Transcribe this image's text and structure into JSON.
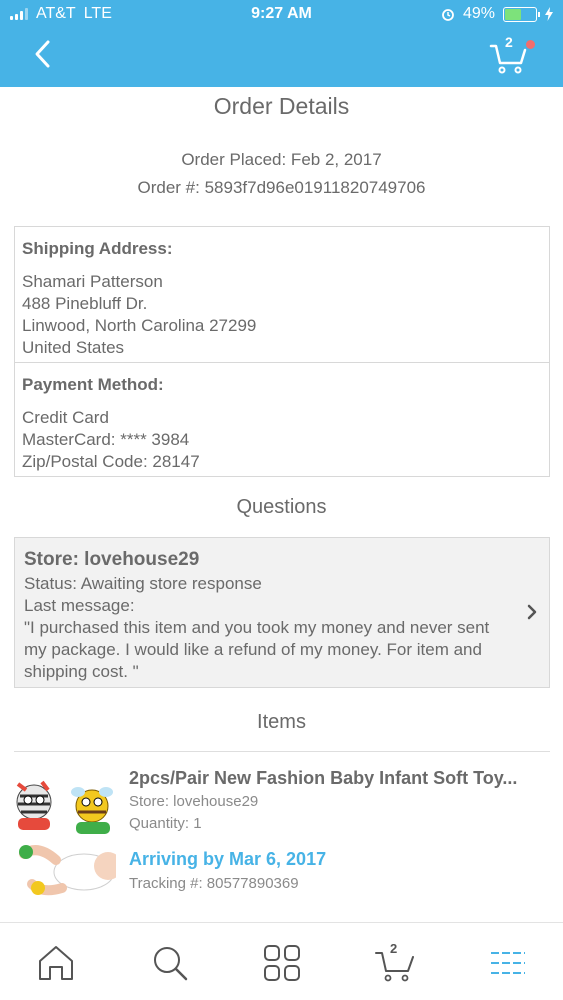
{
  "status_bar": {
    "carrier": "AT&T",
    "network": "LTE",
    "time": "9:27 AM",
    "battery": "49%"
  },
  "header": {
    "cart_count": "2",
    "accent_color": "#47b3e6"
  },
  "page": {
    "title": "Order Details",
    "order_placed": "Order Placed: Feb 2, 2017",
    "order_number": "Order #: 5893f7d96e01911820749706"
  },
  "shipping": {
    "heading": "Shipping Address:",
    "lines": [
      "Shamari Patterson",
      "488 Pinebluff Dr.",
      "Linwood, North Carolina 27299",
      "United States"
    ]
  },
  "payment": {
    "heading": "Payment Method:",
    "lines": [
      "Credit Card",
      "MasterCard: **** 3984",
      "Zip/Postal Code: 28147"
    ]
  },
  "questions": {
    "title": "Questions",
    "store": "Store: lovehouse29",
    "status": "Status: Awaiting store response",
    "last_message_label": "Last message:",
    "message": "\"I purchased this item and you took my money and never sent my package. I would like a refund of my money. For item and shipping cost. \""
  },
  "items": {
    "title": "Items",
    "list": [
      {
        "name": "2pcs/Pair New Fashion Baby Infant Soft Toy...",
        "store": "Store: lovehouse29",
        "quantity": "Quantity: 1",
        "arriving": "Arriving by Mar 6, 2017",
        "tracking": "Tracking #: 80577890369"
      }
    ]
  },
  "tabbar": {
    "items": [
      "home-icon",
      "search-icon",
      "categories-icon",
      "cart-icon",
      "menu-icon"
    ],
    "cart_count": "2",
    "active": "menu-icon"
  }
}
